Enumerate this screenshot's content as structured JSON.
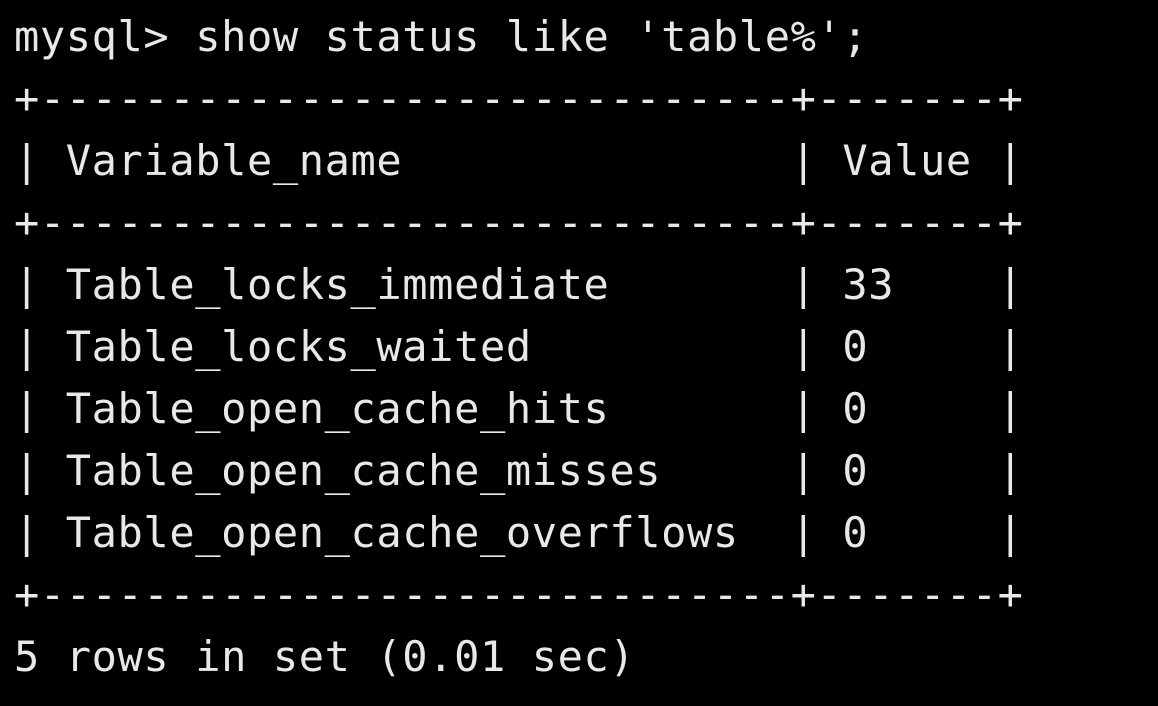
{
  "terminal": {
    "prompt_line": "mysql> show status like 'table%';",
    "border": "+-----------------------------+-------+",
    "header_row": "| Variable_name               | Value |",
    "rows": [
      "| Table_locks_immediate       | 33    |",
      "| Table_locks_waited          | 0     |",
      "| Table_open_cache_hits       | 0     |",
      "| Table_open_cache_misses     | 0     |",
      "| Table_open_cache_overflows  | 0     |"
    ],
    "footer": "5 rows in set (0.01 sec)"
  },
  "colors": {
    "background": "#000000",
    "text": "#e8e8e8"
  }
}
